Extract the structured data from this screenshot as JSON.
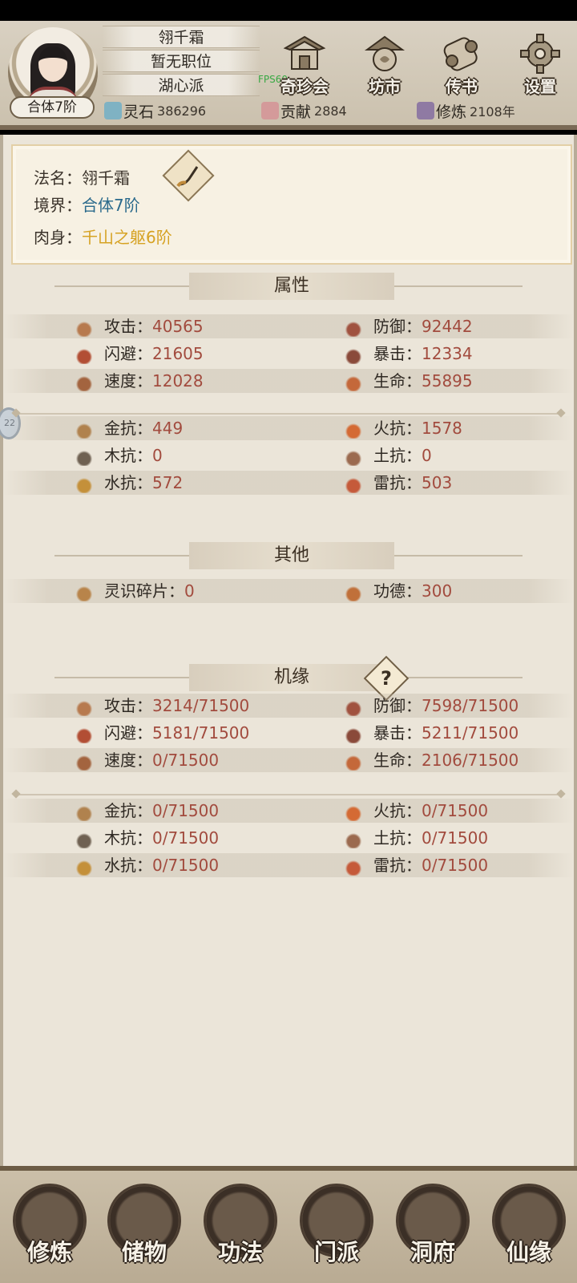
{
  "header": {
    "name": "翎千霜",
    "title": "暂无职位",
    "sect": "湖心派",
    "realm_badge": "合体7阶",
    "fps": "FPS60",
    "nav": [
      {
        "label": "奇珍会",
        "icon": "pavilion-icon"
      },
      {
        "label": "坊市",
        "icon": "market-icon"
      },
      {
        "label": "传书",
        "icon": "scroll-message-icon"
      },
      {
        "label": "设置",
        "icon": "gear-icon"
      }
    ],
    "resources": [
      {
        "label": "灵石",
        "value": "386296",
        "icon": "spirit-stone-icon"
      },
      {
        "label": "贡献",
        "value": "2884",
        "icon": "contribution-icon"
      },
      {
        "label": "修炼",
        "value": "2108年",
        "icon": "cultivation-icon"
      }
    ]
  },
  "profile": {
    "name_label": "法名：",
    "name_value": "翎千霜",
    "realm_label": "境界：",
    "realm_value": "合体7阶",
    "body_label": "肉身：",
    "body_value": "千山之躯6阶"
  },
  "attributes": {
    "title": "属性",
    "basic": [
      {
        "left": {
          "label": "攻击：",
          "value": "40565",
          "icon": "attack-icon"
        },
        "right": {
          "label": "防御：",
          "value": "92442",
          "icon": "defense-icon"
        }
      },
      {
        "left": {
          "label": "闪避：",
          "value": "21605",
          "icon": "dodge-icon"
        },
        "right": {
          "label": "暴击：",
          "value": "12334",
          "icon": "critical-icon"
        }
      },
      {
        "left": {
          "label": "速度：",
          "value": "12028",
          "icon": "speed-icon"
        },
        "right": {
          "label": "生命：",
          "value": "55895",
          "icon": "life-icon"
        }
      }
    ],
    "resist": [
      {
        "left": {
          "label": "金抗：",
          "value": "449",
          "icon": "metal-resist-icon"
        },
        "right": {
          "label": "火抗：",
          "value": "1578",
          "icon": "fire-resist-icon"
        }
      },
      {
        "left": {
          "label": "木抗：",
          "value": "0",
          "icon": "wood-resist-icon"
        },
        "right": {
          "label": "土抗：",
          "value": "0",
          "icon": "earth-resist-icon"
        }
      },
      {
        "left": {
          "label": "水抗：",
          "value": "572",
          "icon": "water-resist-icon"
        },
        "right": {
          "label": "雷抗：",
          "value": "503",
          "icon": "thunder-resist-icon"
        }
      }
    ]
  },
  "other": {
    "title": "其他",
    "row": {
      "left": {
        "label": "灵识碎片：",
        "value": "0",
        "icon": "spirit-fragment-icon"
      },
      "right": {
        "label": "功德：",
        "value": "300",
        "icon": "merit-icon"
      }
    }
  },
  "fortune": {
    "title": "机缘",
    "help": "?",
    "basic": [
      {
        "left": {
          "label": "攻击：",
          "value": "3214/71500"
        },
        "right": {
          "label": "防御：",
          "value": "7598/71500"
        }
      },
      {
        "left": {
          "label": "闪避：",
          "value": "5181/71500"
        },
        "right": {
          "label": "暴击：",
          "value": "5211/71500"
        }
      },
      {
        "left": {
          "label": "速度：",
          "value": "0/71500"
        },
        "right": {
          "label": "生命：",
          "value": "2106/71500"
        }
      }
    ],
    "resist": [
      {
        "left": {
          "label": "金抗：",
          "value": "0/71500"
        },
        "right": {
          "label": "火抗：",
          "value": "0/71500"
        }
      },
      {
        "left": {
          "label": "木抗：",
          "value": "0/71500"
        },
        "right": {
          "label": "土抗：",
          "value": "0/71500"
        }
      },
      {
        "left": {
          "label": "水抗：",
          "value": "0/71500"
        },
        "right": {
          "label": "雷抗：",
          "value": "0/71500"
        }
      }
    ]
  },
  "side_badge": "22",
  "bottom_nav": [
    {
      "label": "修炼",
      "active": true
    },
    {
      "label": "储物",
      "active": false
    },
    {
      "label": "功法",
      "active": false
    },
    {
      "label": "门派",
      "active": false
    },
    {
      "label": "洞府",
      "active": false
    },
    {
      "label": "仙缘",
      "active": false
    }
  ],
  "colors": {
    "value_red": "#a24b3e",
    "realm_blue": "#2b6a8c",
    "body_gold": "#d6a223",
    "bg": "#ebe5d9"
  }
}
